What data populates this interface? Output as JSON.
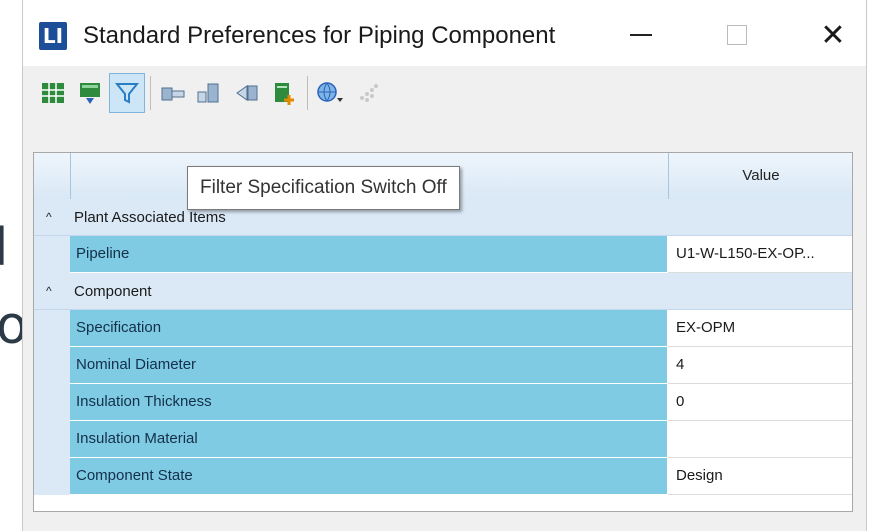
{
  "background": {
    "fragment_1": "l",
    "fragment_2": "o"
  },
  "window": {
    "title": "Standard Preferences for Piping Component",
    "app_icon_glyph": "LI",
    "controls": [
      "minimize-icon",
      "maximize-icon",
      "close-icon"
    ],
    "close_glyph": "✕"
  },
  "toolbar": {
    "buttons": [
      "table-icon",
      "export-icon",
      "filter-icon",
      "component-icon",
      "connected-components-icon",
      "branch-icon",
      "add-sheet-icon",
      "globe-settings-icon",
      "disabled-dots-icon"
    ],
    "active": "filter-icon"
  },
  "tooltip": {
    "text": "Filter Specification Switch Off"
  },
  "grid": {
    "header": {
      "value": "Value"
    },
    "groups": [
      {
        "label": "Plant Associated Items",
        "rows": [
          {
            "property": "Pipeline",
            "value": "U1-W-L150-EX-OP..."
          }
        ]
      },
      {
        "label": "Component",
        "rows": [
          {
            "property": "Specification",
            "value": "EX-OPM"
          },
          {
            "property": "Nominal Diameter",
            "value": "4"
          },
          {
            "property": "Insulation Thickness",
            "value": "0"
          },
          {
            "property": "Insulation Material",
            "value": ""
          },
          {
            "property": "Component State",
            "value": "Design"
          }
        ]
      }
    ],
    "toggle_glyph": "^"
  },
  "colors": {
    "accent": "#1c4f97",
    "property_cell": "#7fcbe3",
    "group_row": "#dbe9f6"
  }
}
